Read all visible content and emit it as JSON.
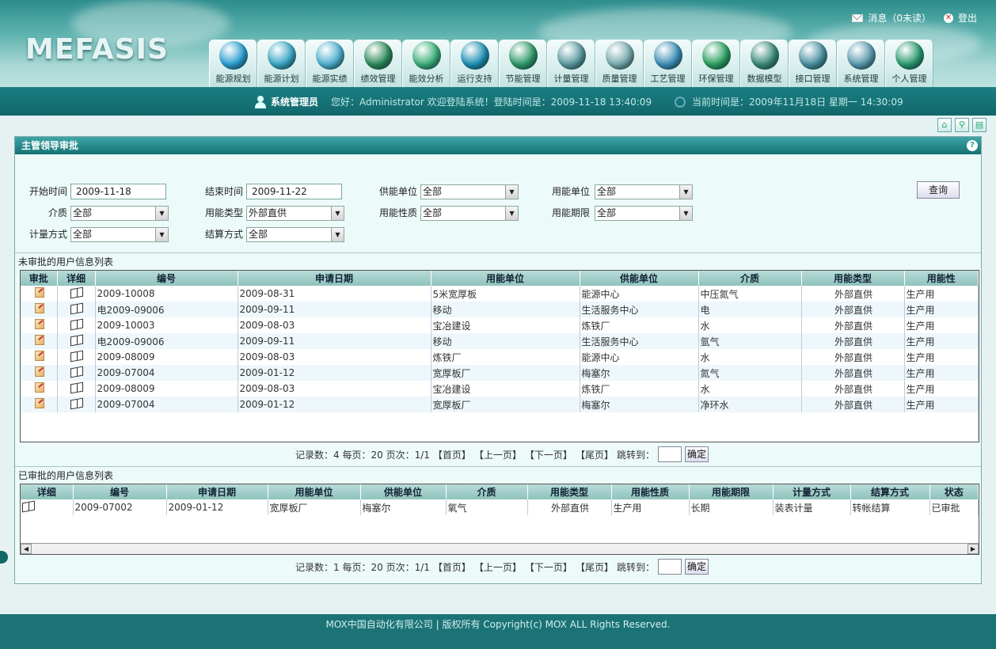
{
  "app": {
    "logo": "MEFASIS"
  },
  "topright": {
    "messages": "消息（0未读）",
    "logout": "登出"
  },
  "nav": [
    {
      "label": "能源规划",
      "icon": "energy-planning-icon",
      "color": "#2a9ed0"
    },
    {
      "label": "能源计划",
      "icon": "energy-plan-icon",
      "color": "#3aa6c6"
    },
    {
      "label": "能源实绩",
      "icon": "energy-actual-icon",
      "color": "#4fb0d0"
    },
    {
      "label": "绩效管理",
      "icon": "performance-icon",
      "color": "#2e8a5a"
    },
    {
      "label": "能效分析",
      "icon": "efficiency-analysis-icon",
      "color": "#3bb07a"
    },
    {
      "label": "运行支持",
      "icon": "operation-support-icon",
      "color": "#1d8fb3"
    },
    {
      "label": "节能管理",
      "icon": "energy-saving-icon",
      "color": "#2f9a6a"
    },
    {
      "label": "计量管理",
      "icon": "metering-icon",
      "color": "#5a9aa0"
    },
    {
      "label": "质量管理",
      "icon": "quality-icon",
      "color": "#7aaab0"
    },
    {
      "label": "工艺管理",
      "icon": "process-icon",
      "color": "#3d8fb8"
    },
    {
      "label": "环保管理",
      "icon": "environment-icon",
      "color": "#2aa060"
    },
    {
      "label": "数据模型",
      "icon": "data-model-icon",
      "color": "#3a8a7a"
    },
    {
      "label": "接口管理",
      "icon": "interface-icon",
      "color": "#4a8fa0"
    },
    {
      "label": "系统管理",
      "icon": "system-icon",
      "color": "#5a9ab0"
    },
    {
      "label": "个人管理",
      "icon": "personal-icon",
      "color": "#2a9a70"
    }
  ],
  "infobar": {
    "role": "系统管理员",
    "welcome": "您好：Administrator 欢迎登陆系统！登陆时间是：2009-11-18 13:40:09",
    "now": "当前时间是：2009年11月18日 星期一 14:30:09"
  },
  "panel": {
    "title": "主管领导审批"
  },
  "filters": {
    "start_label": "开始时间",
    "start_value": "2009-11-18",
    "end_label": "结束时间",
    "end_value": "2009-11-22",
    "supply_label": "供能单位",
    "supply_value": "全部",
    "consumer_label": "用能单位",
    "consumer_value": "全部",
    "medium_label": "介质",
    "medium_value": "全部",
    "usetype_label": "用能类型",
    "usetype_value": "外部直供",
    "usenature_label": "用能性质",
    "usenature_value": "全部",
    "useperiod_label": "用能期限",
    "useperiod_value": "全部",
    "metering_label": "计量方式",
    "metering_value": "全部",
    "settle_label": "结算方式",
    "settle_value": "全部",
    "query": "查询"
  },
  "pending": {
    "title": "未审批的用户信息列表",
    "columns": [
      "审批",
      "详细",
      "编号",
      "申请日期",
      "用能单位",
      "供能单位",
      "介质",
      "用能类型",
      "用能性"
    ],
    "rows": [
      [
        "2009-10008",
        "2009-08-31",
        "5米宽厚板",
        "能源中心",
        "中压氮气",
        "外部直供",
        "生产用"
      ],
      [
        "电2009-09006",
        "2009-09-11",
        "移动",
        "生活服务中心",
        "电",
        "外部直供",
        "生产用"
      ],
      [
        "2009-10003",
        "2009-08-03",
        "宝冶建设",
        "炼铁厂",
        "水",
        "外部直供",
        "生产用"
      ],
      [
        "电2009-09006",
        "2009-09-11",
        "移动",
        "生活服务中心",
        "氩气",
        "外部直供",
        "生产用"
      ],
      [
        "2009-08009",
        "2009-08-03",
        "炼铁厂",
        "能源中心",
        "水",
        "外部直供",
        "生产用"
      ],
      [
        "2009-07004",
        "2009-01-12",
        "宽厚板厂",
        "梅塞尔",
        "氮气",
        "外部直供",
        "生产用"
      ],
      [
        "2009-08009",
        "2009-08-03",
        "宝冶建设",
        "炼铁厂",
        "水",
        "外部直供",
        "生产用"
      ],
      [
        "2009-07004",
        "2009-01-12",
        "宽厚板厂",
        "梅塞尔",
        "净环水",
        "外部直供",
        "生产用"
      ]
    ],
    "pager": {
      "text": "记录数：4 每页：20 页次：1/1",
      "first": "【首页】",
      "prev": "【上一页】",
      "next": "【下一页】",
      "last": "【尾页】",
      "jump": "跳转到：",
      "ok": "确定"
    }
  },
  "approved": {
    "title": "已审批的用户信息列表",
    "columns": [
      "详细",
      "编号",
      "申请日期",
      "用能单位",
      "供能单位",
      "介质",
      "用能类型",
      "用能性质",
      "用能期限",
      "计量方式",
      "结算方式",
      "状态"
    ],
    "rows": [
      [
        "2009-07002",
        "2009-01-12",
        "宽厚板厂",
        "梅塞尔",
        "氧气",
        "外部直供",
        "生产用",
        "长期",
        "装表计量",
        "转帐结算",
        "已审批"
      ]
    ],
    "pager": {
      "text": "记录数：1 每页：20 页次：1/1",
      "first": "【首页】",
      "prev": "【上一页】",
      "next": "【下一页】",
      "last": "【尾页】",
      "jump": "跳转到：",
      "ok": "确定"
    }
  },
  "footer": {
    "text": "MOX中国自动化有限公司 | 版权所有 Copyright(c) MOX ALL Rights Reserved."
  }
}
